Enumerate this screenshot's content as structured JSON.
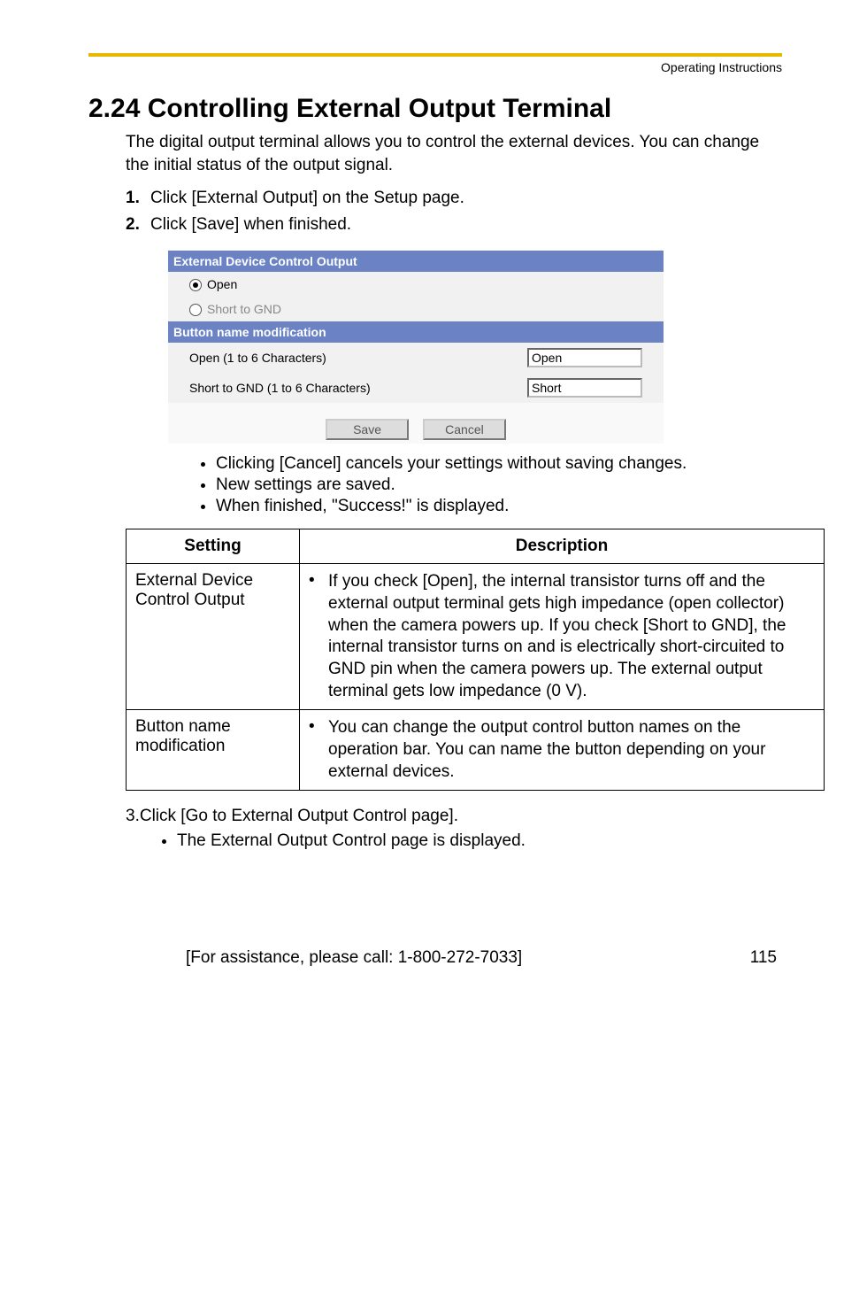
{
  "header": {
    "doc_title": "Operating Instructions"
  },
  "title": "2.24  Controlling External Output Terminal",
  "intro": "The digital output terminal allows you to control the external devices. You can change the initial status of the output signal.",
  "steps": {
    "s1_num": "1.",
    "s1_text": "Click [External Output] on the Setup page.",
    "s2_num": "2.",
    "s2_text": "Click [Save] when finished."
  },
  "screenshot": {
    "bar1": "External Device Control Output",
    "opt_open": "Open",
    "opt_short": "Short to GND",
    "bar2": "Button name modification",
    "lbl_open": "Open (1 to 6 Characters)",
    "val_open": "Open",
    "lbl_short": "Short to GND (1 to 6 Characters)",
    "val_short": "Short",
    "btn_save": "Save",
    "btn_cancel": "Cancel"
  },
  "notes": {
    "n1": "Clicking [Cancel] cancels your settings without saving changes.",
    "n2": "New settings are saved.",
    "n3": "When finished, \"Success!\" is displayed."
  },
  "table": {
    "th_setting": "Setting",
    "th_desc": "Description",
    "r1_setting": "External Device Control Output",
    "r1_desc": "If you check [Open], the internal transistor turns off and the external output terminal gets high impedance (open collector) when the camera powers up. If you check [Short to GND], the internal transistor turns on and is electrically short-circuited to GND pin when the camera powers up. The external output terminal gets low impedance (0 V).",
    "r2_setting": "Button name modification",
    "r2_desc": "You can change the output control button names on the operation bar. You can name the button depending on your external devices."
  },
  "step3": {
    "num": "3.",
    "text": "Click [Go to External Output Control page].",
    "sub": "The External Output Control page is displayed."
  },
  "footer": {
    "assist": "[For assistance, please call: 1-800-272-7033]",
    "page": "115"
  }
}
